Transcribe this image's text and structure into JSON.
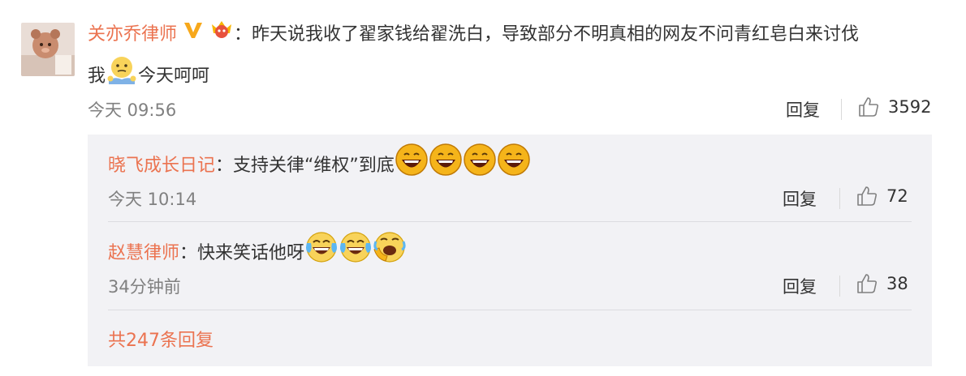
{
  "comment": {
    "author": "关亦乔律师",
    "separator": "：",
    "text_line1": "昨天说我收了翟家钱给翟洗白，导致部分不明真相的网友不问青红皂白来讨伐",
    "text_line2_pre": "我",
    "text_line2_post": "今天呵呵",
    "time": "今天 09:56",
    "reply_label": "回复",
    "likes": "3592",
    "badges": [
      "verified-v-icon",
      "crown-vip-icon"
    ]
  },
  "replies": [
    {
      "author": "晓飞成长日记",
      "separator": "：",
      "text": "支持关律“维权”到底",
      "emojis": [
        "laugh-emoji",
        "laugh-emoji",
        "laugh-emoji",
        "laugh-emoji"
      ],
      "time": "今天 10:14",
      "reply_label": "回复",
      "likes": "72"
    },
    {
      "author": "赵慧律师",
      "separator": "：",
      "text": "快来笑话他呀",
      "emojis": [
        "tears-of-joy-emoji",
        "tears-of-joy-emoji",
        "rofl-emoji"
      ],
      "time": "34分钟前",
      "reply_label": "回复",
      "likes": "38"
    }
  ],
  "more_replies": "共247条回复",
  "colors": {
    "accent": "#eb7350",
    "meta": "#808080",
    "reply_bg": "#f2f2f5"
  }
}
